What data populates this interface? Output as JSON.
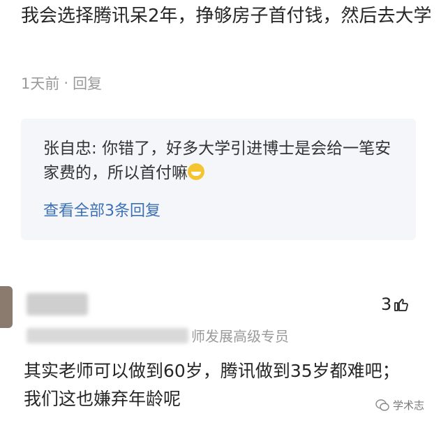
{
  "comment1": {
    "text": "我会选择腾讯呆2年，挣够房子首付钱，然后去大学",
    "time": "1天前",
    "reply_label": "回复"
  },
  "reply": {
    "author": "张自忠:",
    "text": "你错了，好多大学引进博士是会给一笔安家费的，所以首付嘛",
    "view_all": "查看全部3条回复"
  },
  "comment2": {
    "title_suffix": "师发展高级专员",
    "likes": "3",
    "text": "其实老师可以做到60岁，腾讯做到35岁都难吧；我们这也嫌弃年龄呢"
  },
  "watermark": {
    "text": "学术志"
  }
}
